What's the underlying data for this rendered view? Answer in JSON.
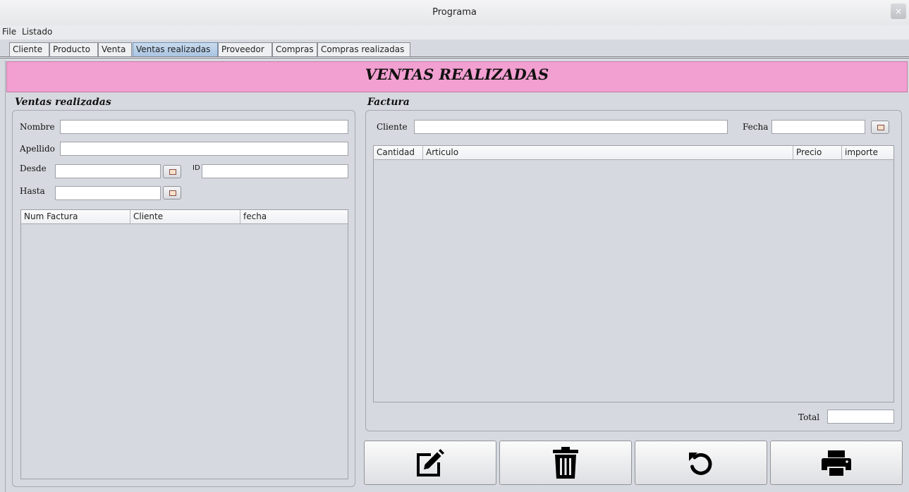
{
  "window": {
    "title": "Programa",
    "close_glyph": "×"
  },
  "menu": {
    "items": [
      "File",
      "Listado"
    ]
  },
  "tabs": [
    "Cliente",
    "Producto",
    "Venta",
    "Ventas realizadas",
    "Proveedor",
    "Compras",
    "Compras realizadas"
  ],
  "active_tab": "Ventas realizadas",
  "banner": {
    "title": "VENTAS REALIZADAS",
    "color": "#f29fd1"
  },
  "left": {
    "section_title": "Ventas realizadas",
    "nombre_label": "Nombre",
    "nombre_value": "",
    "apellido_label": "Apellido",
    "apellido_value": "",
    "desde_label": "Desde",
    "desde_value": "",
    "id_label": "ID",
    "id_value": "",
    "hasta_label": "Hasta",
    "hasta_value": "",
    "table": {
      "columns": [
        "Num Factura",
        "Cliente",
        "fecha"
      ],
      "rows": []
    }
  },
  "right": {
    "section_title": "Factura",
    "cliente_label": "Cliente",
    "cliente_value": "",
    "fecha_label": "Fecha",
    "fecha_value": "",
    "table": {
      "columns": [
        "Cantidad",
        "Articulo",
        "Precio",
        "importe"
      ],
      "rows": []
    },
    "total_label": "Total",
    "total_value": ""
  },
  "actions": [
    {
      "name": "edit",
      "icon": "edit-icon"
    },
    {
      "name": "delete",
      "icon": "trash-icon"
    },
    {
      "name": "refresh",
      "icon": "undo-icon"
    },
    {
      "name": "print",
      "icon": "printer-icon"
    }
  ]
}
